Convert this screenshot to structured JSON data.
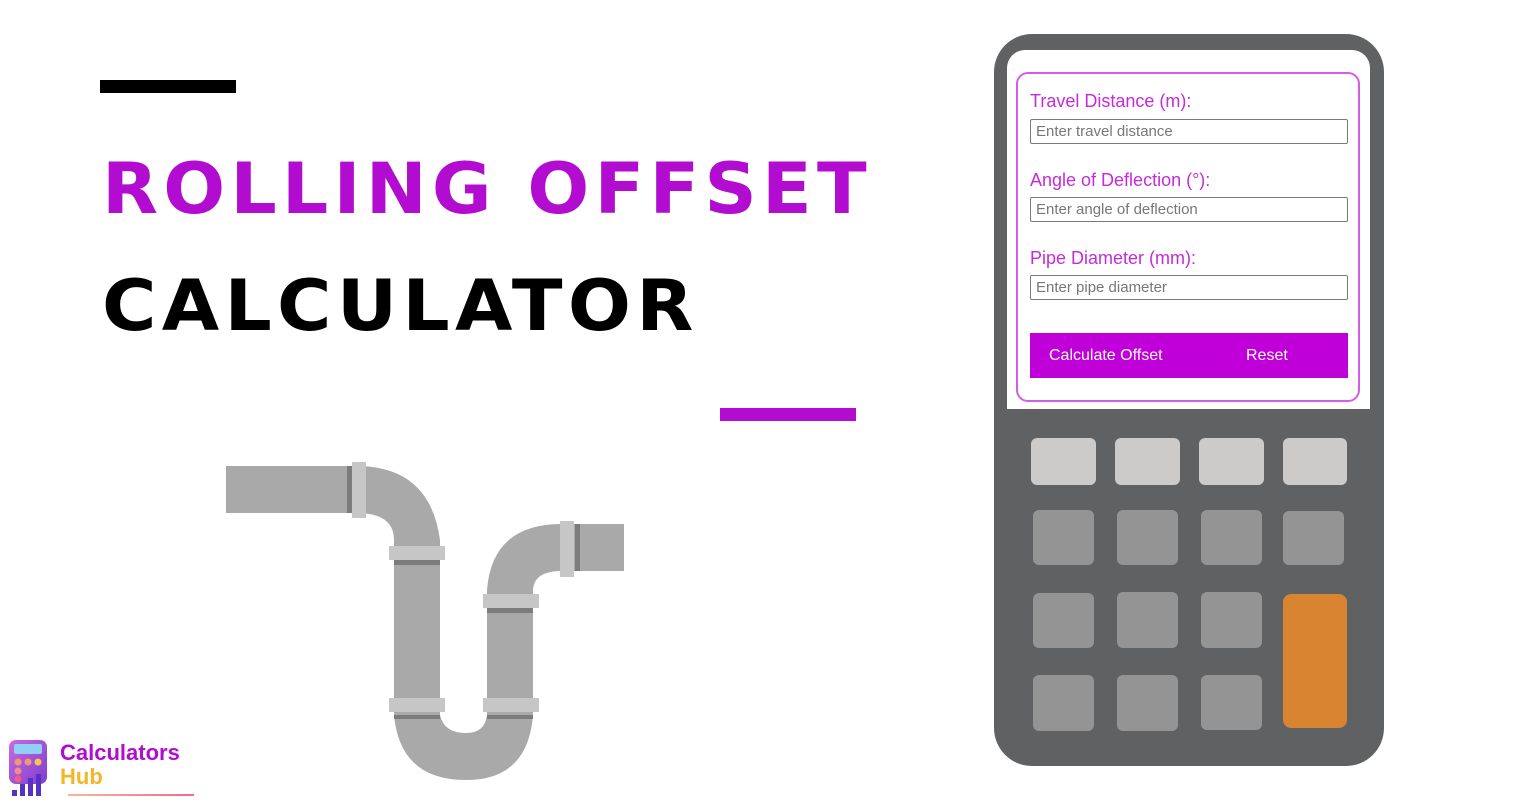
{
  "title": {
    "line1": "ROLLING OFFSET",
    "line2": "CALCULATOR"
  },
  "brand": {
    "line1": "Calculators",
    "line2": "Hub"
  },
  "form": {
    "fields": [
      {
        "label": "Travel Distance (m):",
        "placeholder": "Enter travel distance",
        "value": ""
      },
      {
        "label": "Angle of Deflection (°):",
        "placeholder": "Enter angle of deflection",
        "value": ""
      },
      {
        "label": "Pipe Diameter (mm):",
        "placeholder": "Enter pipe diameter",
        "value": ""
      }
    ],
    "calculate_label": "Calculate Offset",
    "reset_label": "Reset"
  },
  "colors": {
    "accent": "#b20cd0",
    "button": "#c000d8",
    "calculator_body": "#606163",
    "key_orange": "#d98430"
  }
}
